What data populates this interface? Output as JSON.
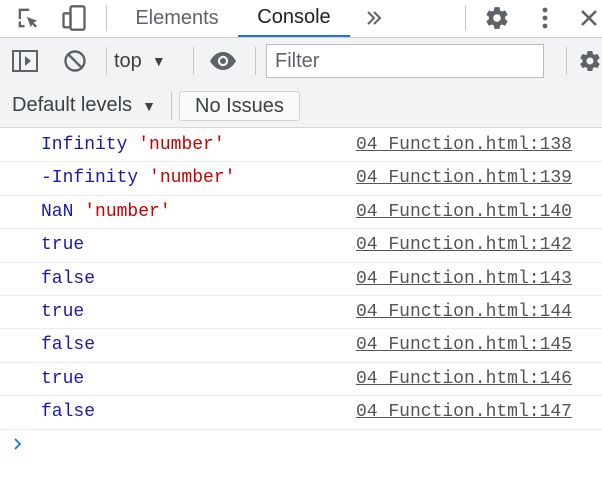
{
  "tabs": [
    {
      "label": "Elements",
      "active": false
    },
    {
      "label": "Console",
      "active": true
    }
  ],
  "toolbar": {
    "context": "top",
    "filter_placeholder": "Filter",
    "filter_value": ""
  },
  "levels": {
    "dropdown": "Default levels",
    "issues_button": "No Issues"
  },
  "messages": [
    {
      "value": "Infinity",
      "string": "'number'",
      "source": "04 Function.html:138"
    },
    {
      "value": "-Infinity",
      "string": "'number'",
      "source": "04 Function.html:139"
    },
    {
      "value": "NaN",
      "string": "'number'",
      "source": "04 Function.html:140"
    },
    {
      "value": "true",
      "string": "",
      "source": "04 Function.html:142"
    },
    {
      "value": "false",
      "string": "",
      "source": "04 Function.html:143"
    },
    {
      "value": "true",
      "string": "",
      "source": "04 Function.html:144"
    },
    {
      "value": "false",
      "string": "",
      "source": "04 Function.html:145"
    },
    {
      "value": "true",
      "string": "",
      "source": "04 Function.html:146"
    },
    {
      "value": "false",
      "string": "",
      "source": "04 Function.html:147"
    }
  ],
  "icons": {
    "inspect": "inspect-element-icon",
    "device": "device-toolbar-icon",
    "more_tabs": "more-tabs-icon",
    "settings": "gear-icon",
    "menu": "kebab-menu-icon",
    "close": "close-icon",
    "sidebar": "sidebar-toggle-icon",
    "clear": "clear-console-icon",
    "live_expression": "eye-icon",
    "prompt": "chevron-right-icon"
  },
  "colors": {
    "accent": "#1a73e8",
    "value": "#1a1aa6",
    "string": "#c80000",
    "link": "#545454",
    "toolbar_bg": "#f1f3f4"
  }
}
